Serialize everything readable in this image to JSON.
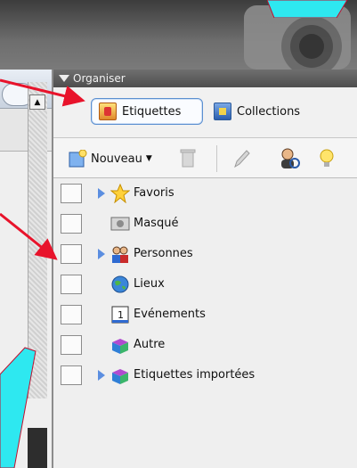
{
  "panel": {
    "title": "Organiser",
    "tabs": [
      {
        "label": "Etiquettes",
        "active": true
      },
      {
        "label": "Collections",
        "active": false
      }
    ]
  },
  "toolbar": {
    "new_label": "Nouveau",
    "icons": [
      "new-tag-icon",
      "dropdown-arrow-icon",
      "trash-icon",
      "pencil-icon",
      "find-person-icon",
      "lightbulb-icon"
    ]
  },
  "tags": [
    {
      "label": "Favoris",
      "icon": "star-icon",
      "expandable": true
    },
    {
      "label": "Masqué",
      "icon": "hidden-icon",
      "expandable": false
    },
    {
      "label": "Personnes",
      "icon": "people-icon",
      "expandable": true
    },
    {
      "label": "Lieux",
      "icon": "globe-icon",
      "expandable": false
    },
    {
      "label": "Evénements",
      "icon": "calendar-icon",
      "expandable": false
    },
    {
      "label": "Autre",
      "icon": "box-icon",
      "expandable": false
    },
    {
      "label": "Etiquettes importées",
      "icon": "box-icon",
      "expandable": true
    }
  ],
  "colors": {
    "accent": "#5b8fd0",
    "panel_header": "#5e5e5e",
    "annotation_arrow": "#e8132b",
    "highlight_shape": "#2ee8f0"
  }
}
